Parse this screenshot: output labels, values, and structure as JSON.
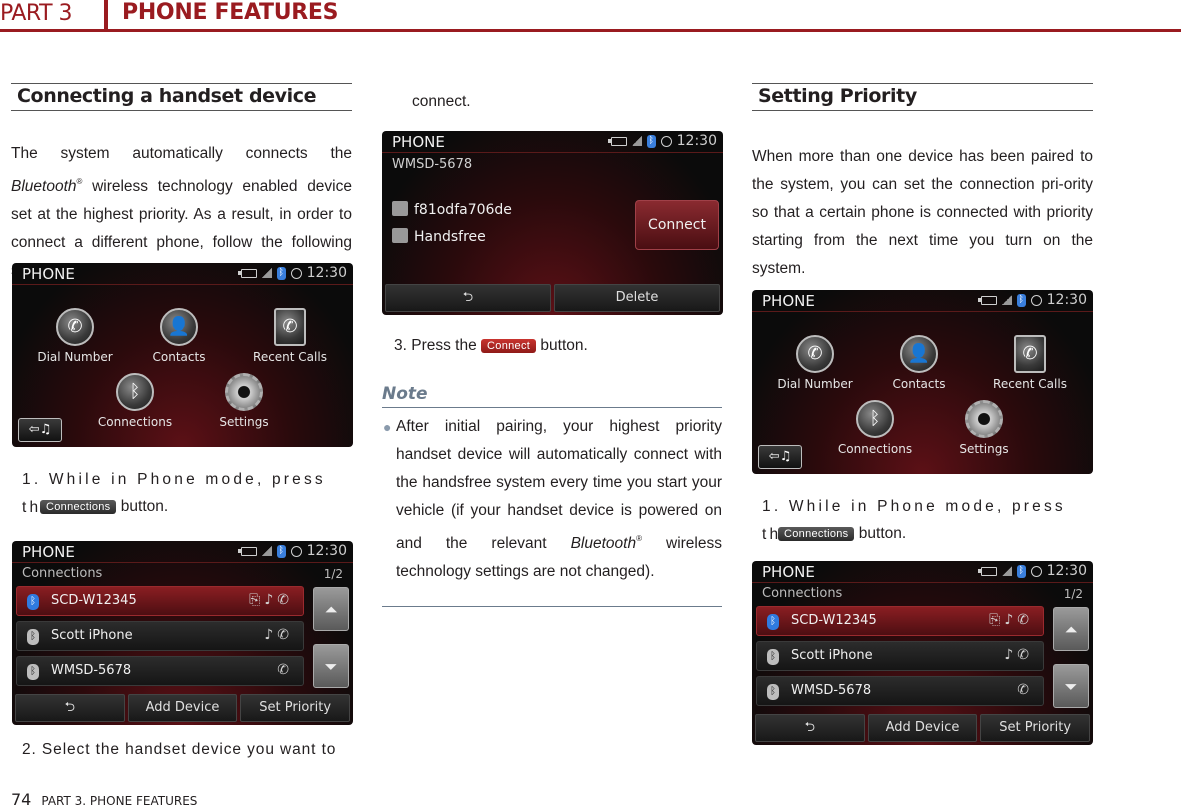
{
  "header": {
    "part": "PART 3",
    "title": "PHONE FEATURES"
  },
  "footer": {
    "page_number": "74",
    "label": "PART 3. PHONE FEATURES"
  },
  "colors": {
    "brand": "#9a1b20",
    "note": "#6b7b8c",
    "bt_active": "#2f7ae0"
  },
  "section1": {
    "heading": "Connecting a handset device",
    "intro_pre": "The system automatically connects the ",
    "intro_italic": "Bluetooth",
    "intro_sup": "®",
    "intro_post": " wireless technology enabled device set at the highest priority. As a result, in order to connect a different phone, follow the following steps.",
    "step1_text": "1. While in Phone mode, press the",
    "step1_chip": "Connections",
    "step1_suffix": "button.",
    "step2_text": "2. Select the handset device you want to",
    "step2_cont": "connect.",
    "step3_pre": "3. Press the",
    "step3_chip": "Connect",
    "step3_suffix": "button."
  },
  "note": {
    "heading": "Note",
    "bullet": "●",
    "pre": "After initial pairing, your highest priority handset device will automatically connect with the handsfree system every time you start your vehicle (if your handset device is powered on and the relevant ",
    "italic": "Bluetooth",
    "sup": "®",
    "post": " wireless technology settings are not changed)."
  },
  "section2": {
    "heading": "Setting Priority",
    "intro": "When more than one device has been paired to the system, you can set the connection pri-ority so that a certain phone is connected with priority starting from the next time you turn on the system.",
    "step1_text": "1. While in Phone mode, press the",
    "step1_chip": "Connections",
    "step1_suffix": "button."
  },
  "screen_common": {
    "title": "PHONE",
    "time": "12:30",
    "bt_glyph": "ᛒ"
  },
  "home_screen": {
    "items": [
      {
        "label": "Dial Number",
        "icon": "phone-icon",
        "glyph": "✆"
      },
      {
        "label": "Contacts",
        "icon": "contacts-icon",
        "glyph": "👤"
      },
      {
        "label": "Recent Calls",
        "icon": "recent-calls-icon",
        "glyph": "✆"
      },
      {
        "label": "Connections",
        "icon": "bluetooth-icon",
        "glyph": "ᛒ"
      },
      {
        "label": "Settings",
        "icon": "gear-icon",
        "glyph": ""
      }
    ],
    "back_glyph": "⇦♫"
  },
  "connections_screen": {
    "subtitle": "Connections",
    "page": "1/2",
    "devices": [
      {
        "name": "SCD-W12345",
        "features": "⎘♪✆",
        "selected": true
      },
      {
        "name": "Scott iPhone",
        "features": "♪✆",
        "selected": false
      },
      {
        "name": "WMSD-5678",
        "features": "✆",
        "selected": false
      }
    ],
    "scroll_up": "⏶",
    "scroll_down": "⏷",
    "buttons": [
      "⮌",
      "Add Device",
      "Set Priority"
    ]
  },
  "device_screen": {
    "device": "WMSD-5678",
    "address": "f81odfa706de",
    "profile": "Handsfree",
    "connect": "Connect",
    "buttons": [
      "⮌",
      "Delete"
    ]
  }
}
